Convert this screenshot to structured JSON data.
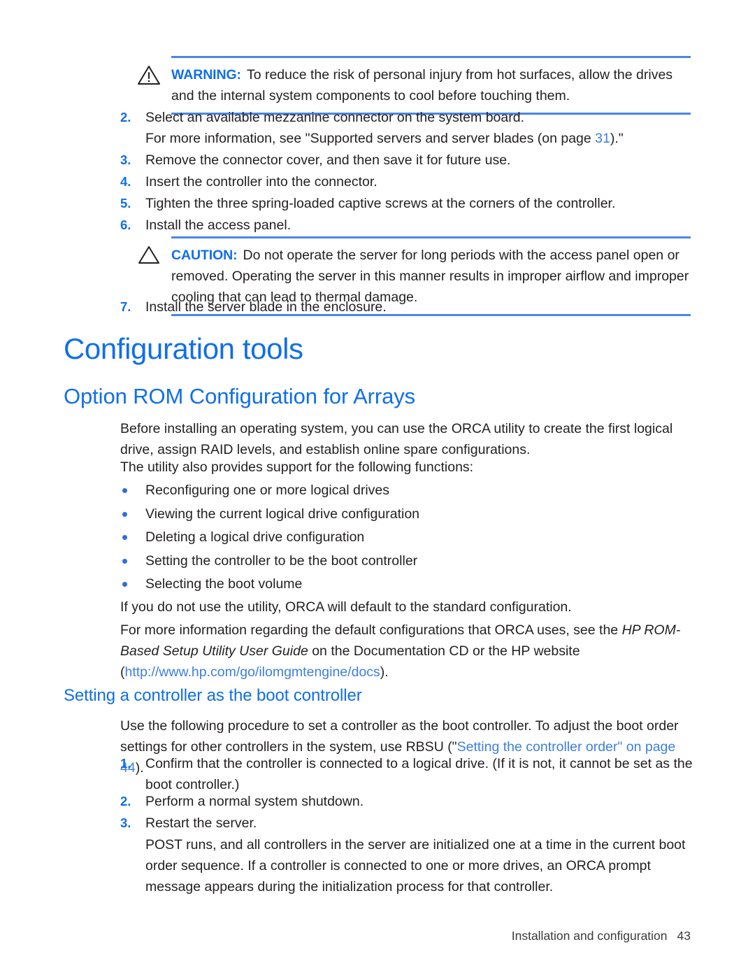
{
  "document": {
    "footer_title": "Installation and configuration",
    "page_number": "43"
  },
  "colors": {
    "heading_blue": "#0f6fe8",
    "rule_blue": "#4a86e8",
    "link_blue": "#3d7fe0",
    "bullet_blue": "#2a6fdb",
    "body_text": "#231f20"
  },
  "warning_box": {
    "icon": "warning-triangle-icon",
    "label": "WARNING:",
    "text": "To reduce the risk of personal injury from hot surfaces, allow the drives and the internal system components to cool before touching them."
  },
  "caution_box": {
    "icon": "caution-triangle-icon",
    "label": "CAUTION:",
    "text": "Do not operate the server for long periods with the access panel open or removed. Operating the server in this manner results in improper airflow and improper cooling that can lead to thermal damage."
  },
  "steps_install": [
    {
      "num": "2.",
      "text": "Select an available mezzanine connector on the system board."
    },
    {
      "num": "3.",
      "text": "Remove the connector cover, and then save it for future use."
    },
    {
      "num": "4.",
      "text": "Insert the controller into the connector."
    },
    {
      "num": "5.",
      "text": "Tighten the three spring-loaded captive screws at the corners of the controller."
    },
    {
      "num": "6.",
      "text": "Install the access panel."
    },
    {
      "num": "7.",
      "text": "Install the server blade in the enclosure."
    }
  ],
  "step2_note": {
    "prefix": "For more information, see \"Supported servers and server blades (on page ",
    "link": "31",
    "suffix": ").\""
  },
  "headings": {
    "h1": "Configuration tools",
    "h2": "Option ROM Configuration for Arrays",
    "h3": "Setting a controller as the boot controller"
  },
  "orca": {
    "intro": "Before installing an operating system, you can use the ORCA utility to create the first logical drive, assign RAID levels, and establish online spare configurations.",
    "functions_lead": "The utility also provides support for the following functions:",
    "functions": [
      "Reconfiguring one or more logical drives",
      "Viewing the current logical drive configuration",
      "Deleting a logical drive configuration",
      "Setting the controller to be the boot controller",
      "Selecting the boot volume"
    ],
    "default_note": "If you do not use the utility, ORCA will default to the standard configuration.",
    "guide_ref": {
      "prefix": "For more information regarding the default configurations that ORCA uses, see the ",
      "italic": "HP ROM-Based Setup Utility User Guide",
      "middle": " on the Documentation CD or the HP website (",
      "link": "http://www.hp.com/go/ilomgmtengine/docs",
      "suffix": ")."
    }
  },
  "boot_controller": {
    "intro": {
      "prefix": "Use the following procedure to set a controller as the boot controller. To adjust the boot order settings for other controllers in the system, use RBSU (\"",
      "link_text": "Setting the controller order",
      "middle": "\" on page ",
      "link_page": "44",
      "suffix": ")."
    },
    "steps": [
      {
        "num": "1.",
        "text": "Confirm that the controller is connected to a logical drive. (If it is not, it cannot be set as the boot controller.)"
      },
      {
        "num": "2.",
        "text": "Perform a normal system shutdown."
      },
      {
        "num": "3.",
        "text": "Restart the server."
      }
    ],
    "post_note": "POST runs, and all controllers in the server are initialized one at a time in the current boot order sequence. If a controller is connected to one or more drives, an ORCA prompt message appears during the initialization process for that controller."
  }
}
